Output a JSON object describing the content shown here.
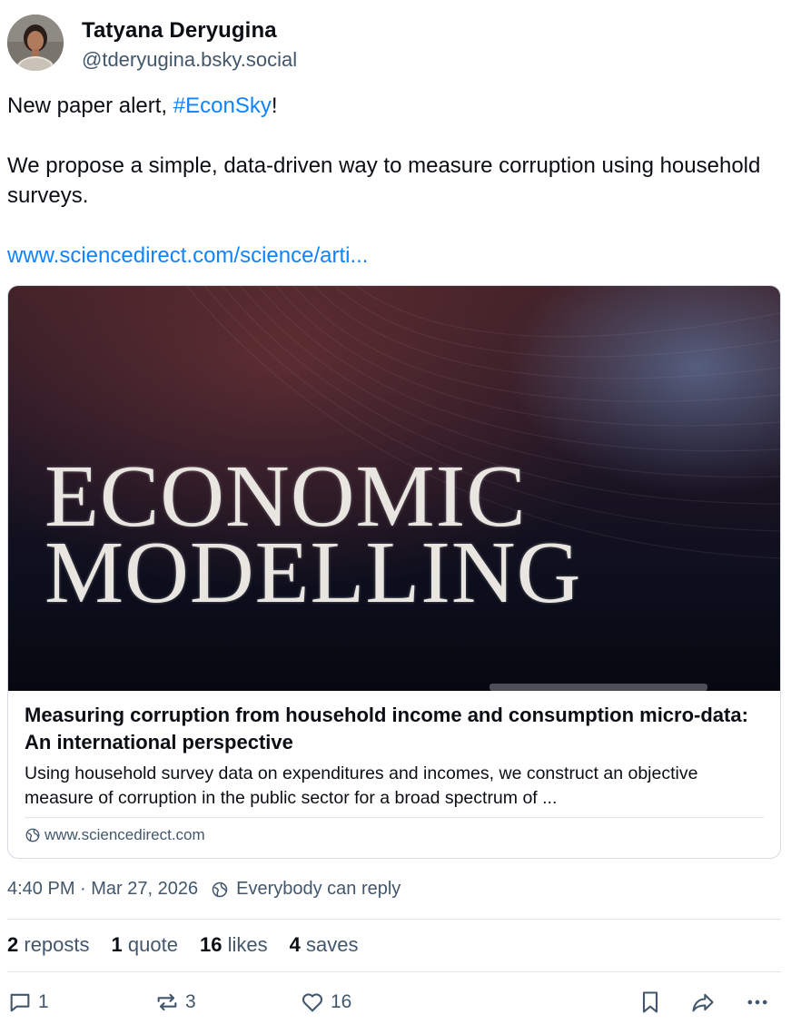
{
  "author": {
    "name": "Tatyana Deryugina",
    "handle": "@tderyugina.bsky.social"
  },
  "post": {
    "line1_prefix": "New paper alert, ",
    "hashtag": "#EconSky",
    "line1_suffix": "!",
    "line2": "We propose a simple, data-driven way to measure corruption using household surveys.",
    "link_text": "www.sciencedirect.com/science/arti..."
  },
  "card": {
    "image_text_line1": "ECONOMIC",
    "image_text_line2": "MODELLING",
    "title": "Measuring corruption from household income and consumption micro-data: An international perspective",
    "description": "Using household survey data on expenditures and incomes, we construct an objective measure of corruption in the public sector for a broad spectrum of ...",
    "domain": "www.sciencedirect.com"
  },
  "meta": {
    "timestamp": "4:40 PM · Mar 27, 2026",
    "reply_setting": "Everybody can reply"
  },
  "stats": {
    "reposts_count": "2",
    "reposts_label": "reposts",
    "quotes_count": "1",
    "quotes_label": "quote",
    "likes_count": "16",
    "likes_label": "likes",
    "saves_count": "4",
    "saves_label": "saves"
  },
  "actions": {
    "reply_count": "1",
    "repost_count": "3",
    "like_count": "16",
    "icons": [
      "reply-icon",
      "repost-icon",
      "like-icon",
      "bookmark-icon",
      "share-icon",
      "more-icon"
    ]
  },
  "colors": {
    "link": "#1083fe",
    "muted": "#42576c",
    "text": "#0b0f14",
    "border": "#d4dbe2"
  }
}
